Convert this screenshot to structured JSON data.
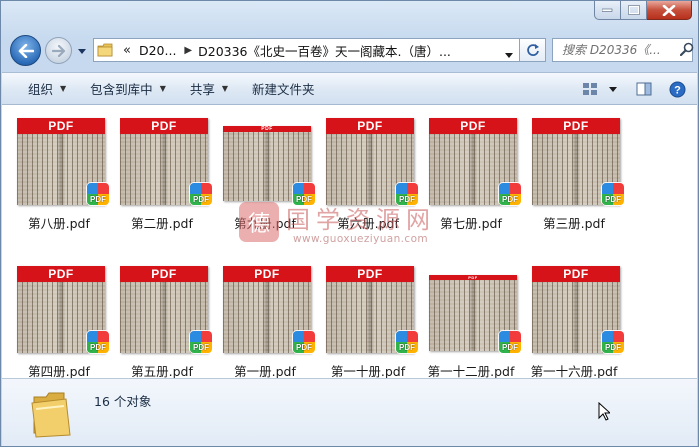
{
  "window": {
    "caption_buttons": [
      "minimize",
      "maximize",
      "close"
    ]
  },
  "nav": {
    "address_crumbs": [
      "D20...",
      "D20336《北史一百卷》天一阁藏本.（唐）..."
    ],
    "overflow_marker": "«",
    "search_placeholder": "搜索 D20336《..."
  },
  "toolbar": {
    "organize": "组织",
    "include_in_library": "包含到库中",
    "share": "共享",
    "new_folder": "新建文件夹"
  },
  "files": [
    {
      "name": "第八册.pdf",
      "band_text": "PDF",
      "style": "normal"
    },
    {
      "name": "第二册.pdf",
      "band_text": "PDF",
      "style": "normal"
    },
    {
      "name": "第九册.pdf",
      "band_text": "PDF",
      "style": "thin"
    },
    {
      "name": "第六册.pdf",
      "band_text": "PDF",
      "style": "normal"
    },
    {
      "name": "第七册.pdf",
      "band_text": "PDF",
      "style": "normal"
    },
    {
      "name": "第三册.pdf",
      "band_text": "PDF",
      "style": "normal"
    },
    {
      "name": "第四册.pdf",
      "band_text": "PDF",
      "style": "normal"
    },
    {
      "name": "第五册.pdf",
      "band_text": "PDF",
      "style": "normal"
    },
    {
      "name": "第一册.pdf",
      "band_text": "PDF",
      "style": "normal"
    },
    {
      "name": "第一十册.pdf",
      "band_text": "PDF",
      "style": "normal"
    },
    {
      "name": "第一十二册.pdf",
      "band_text": "PDF",
      "style": "short"
    },
    {
      "name": "第一十六册.pdf",
      "band_text": "PDF",
      "style": "normal"
    }
  ],
  "badge_text": "PDF",
  "watermark": {
    "text": "国学资源网",
    "url": "www.guoxueziyuan.com",
    "seal": "德"
  },
  "status": {
    "count": "16 个对象"
  },
  "colors": {
    "pdf_band": "#d7131a",
    "window_bg": "#cfe0f1"
  }
}
